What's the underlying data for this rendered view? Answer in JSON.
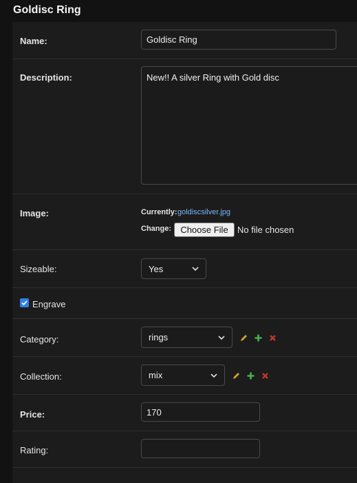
{
  "page": {
    "title": "Goldisc Ring"
  },
  "fields": {
    "name": {
      "label": "Name:",
      "value": "Goldisc Ring"
    },
    "description": {
      "label": "Description:",
      "value": "New!! A silver Ring with Gold disc"
    },
    "image": {
      "label": "Image:",
      "currently_label": "Currently:",
      "currently_value": "goldiscsilver.jpg",
      "change_label": "Change:",
      "button_label": "Choose File",
      "status": "No file chosen"
    },
    "sizeable": {
      "label": "Sizeable:",
      "value": "Yes"
    },
    "engrave": {
      "label": "Engrave",
      "checked": true
    },
    "category": {
      "label": "Category:",
      "value": "rings"
    },
    "collection": {
      "label": "Collection:",
      "value": "mix"
    },
    "price": {
      "label": "Price:",
      "value": "170"
    },
    "rating": {
      "label": "Rating:",
      "value": ""
    }
  },
  "icons": {
    "edit": "pencil-icon",
    "add": "plus-icon",
    "delete": "x-icon",
    "dropdown": "chevron-down-icon",
    "check": "checkmark-icon"
  },
  "colors": {
    "background": "#121212",
    "panel": "#1c1c1c",
    "link": "#79b8ff",
    "edit_icon": "#d4a22a",
    "add_icon": "#4caf50",
    "delete_icon": "#c0392b",
    "checkbox": "#2f80ed"
  }
}
